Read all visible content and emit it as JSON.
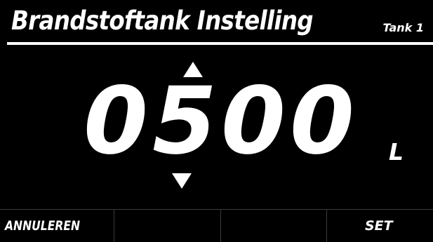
{
  "header": {
    "title": "Brandstoftank Instelling",
    "tank": "Tank 1"
  },
  "setting": {
    "value_digits": [
      "0",
      "5",
      "0",
      "0"
    ],
    "selected_digit_index": 1,
    "unit": "L",
    "increase_icon": "triangle-up-icon",
    "decrease_icon": "triangle-down-icon"
  },
  "softkeys": {
    "left_label": "ANNULEREN",
    "key2_label": "",
    "key3_label": "",
    "right_label": "SET"
  },
  "colors": {
    "background": "#000000",
    "foreground": "#ffffff",
    "divider": "#3a3a3a"
  }
}
